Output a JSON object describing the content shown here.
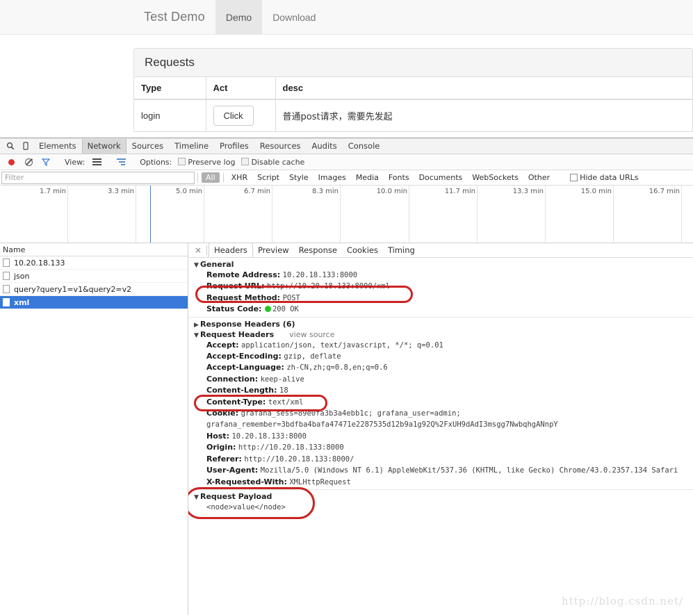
{
  "page": {
    "brand": "Test Demo",
    "nav": [
      {
        "label": "Demo",
        "active": true
      },
      {
        "label": "Download",
        "active": false
      }
    ],
    "panel_title": "Requests",
    "table": {
      "headers": [
        "Type",
        "Act",
        "desc"
      ],
      "rows": [
        {
          "type": "login",
          "act": "Click",
          "desc": "普通post请求，需要先发起"
        }
      ]
    }
  },
  "devtools": {
    "panels": [
      "Elements",
      "Network",
      "Sources",
      "Timeline",
      "Profiles",
      "Resources",
      "Audits",
      "Console"
    ],
    "active_panel": "Network",
    "search_icon": "search-icon",
    "device_icon": "device-toggle-icon",
    "toolbar": {
      "record_icon": "record-icon",
      "clear_icon": "clear-icon",
      "filter_icon": "funnel-icon",
      "view_label": "View:",
      "view_list_icon": "list-view-icon",
      "view_waterfall_icon": "waterfall-view-icon",
      "options_label": "Options:",
      "preserve_log": "Preserve log",
      "preserve_log_checked": false,
      "disable_cache": "Disable cache",
      "disable_cache_checked": false
    },
    "filter": {
      "placeholder": "Filter",
      "value": "",
      "types": [
        "All",
        "XHR",
        "Script",
        "Style",
        "Images",
        "Media",
        "Fonts",
        "Documents",
        "WebSockets",
        "Other"
      ],
      "active_type": "All",
      "hide_data_urls": "Hide data URLs",
      "hide_data_urls_checked": false
    },
    "overview": {
      "ticks": [
        "1.7 min",
        "3.3 min",
        "5.0 min",
        "6.7 min",
        "8.3 min",
        "10.0 min",
        "11.7 min",
        "13.3 min",
        "15.0 min",
        "16.7 min"
      ],
      "marker_label": "5.0 min"
    },
    "requests": {
      "column_header": "Name",
      "items": [
        {
          "name": "10.20.18.133",
          "selected": false
        },
        {
          "name": "json",
          "selected": false
        },
        {
          "name": "query?query1=v1&query2=v2",
          "selected": false
        },
        {
          "name": "xml",
          "selected": true
        }
      ]
    },
    "detail": {
      "close_label": "×",
      "tabs": [
        "Headers",
        "Preview",
        "Response",
        "Cookies",
        "Timing"
      ],
      "active_tab": "Headers",
      "general": {
        "title": "General",
        "rows": [
          {
            "key": "Remote Address:",
            "value": "10.20.18.133:8000"
          },
          {
            "key": "Request URL:",
            "value": "http://10.20.18.133:8000/xml"
          },
          {
            "key": "Request Method:",
            "value": "POST"
          },
          {
            "key": "Status Code:",
            "value": "200 OK",
            "status_dot": "#1ec81e"
          }
        ]
      },
      "response_headers": {
        "title": "Response Headers (6)",
        "collapsed": true
      },
      "request_headers": {
        "title": "Request Headers",
        "view_source": "view source",
        "rows": [
          {
            "key": "Accept:",
            "value": "application/json, text/javascript, */*; q=0.01"
          },
          {
            "key": "Accept-Encoding:",
            "value": "gzip, deflate"
          },
          {
            "key": "Accept-Language:",
            "value": "zh-CN,zh;q=0.8,en;q=0.6"
          },
          {
            "key": "Connection:",
            "value": "keep-alive"
          },
          {
            "key": "Content-Length:",
            "value": "18"
          },
          {
            "key": "Content-Type:",
            "value": "text/xml"
          },
          {
            "key": "Cookie:",
            "value": "grafana_sess=89e0fa3b3a4ebb1c; grafana_user=admin; grafana_remember=3bdfba4bafa47471e2287535d12b9a1g92Q%2FxUH9dAdI3msgg7NwbqhgANnpY"
          },
          {
            "key": "Host:",
            "value": "10.20.18.133:8000"
          },
          {
            "key": "Origin:",
            "value": "http://10.20.18.133:8000"
          },
          {
            "key": "Referer:",
            "value": "http://10.20.18.133:8000/"
          },
          {
            "key": "User-Agent:",
            "value": "Mozilla/5.0 (Windows NT 6.1) AppleWebKit/537.36 (KHTML, like Gecko) Chrome/43.0.2357.134 Safari"
          },
          {
            "key": "X-Requested-With:",
            "value": "XMLHttpRequest"
          }
        ],
        "cookie_wrap": "g92Q%2FxUH9dAdI3msgg7NwbqhgANnpY"
      },
      "request_payload": {
        "title": "Request Payload",
        "body": "<node>value</node>"
      }
    }
  },
  "watermark": "http://blog.csdn.net/",
  "colors": {
    "selection": "#3879d9",
    "annotation": "#cc2222",
    "status_ok": "#1ec81e",
    "record": "#e03030"
  }
}
